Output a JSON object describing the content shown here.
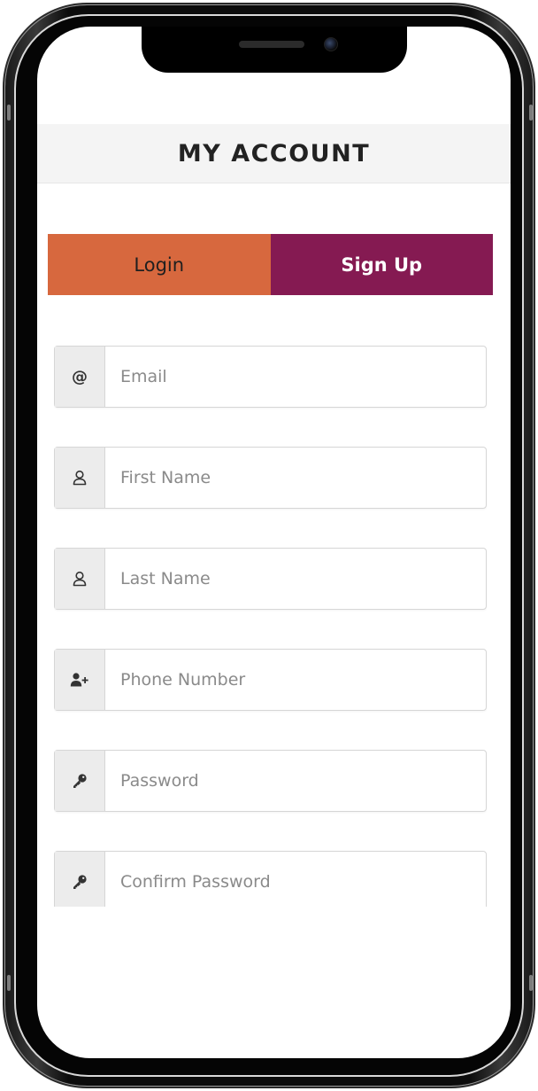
{
  "header": {
    "title": "MY ACCOUNT"
  },
  "tabs": [
    {
      "label": "Login",
      "active": false,
      "color": "#d7683e"
    },
    {
      "label": "Sign Up",
      "active": true,
      "color": "#851a52"
    }
  ],
  "form": {
    "fields": [
      {
        "name": "email",
        "icon": "at-icon",
        "placeholder": "Email",
        "value": ""
      },
      {
        "name": "first_name",
        "icon": "user-icon",
        "placeholder": "First Name",
        "value": ""
      },
      {
        "name": "last_name",
        "icon": "user-icon",
        "placeholder": "Last Name",
        "value": ""
      },
      {
        "name": "phone",
        "icon": "user-plus-icon",
        "placeholder": "Phone Number",
        "value": ""
      },
      {
        "name": "password",
        "icon": "key-icon",
        "placeholder": "Password",
        "value": ""
      },
      {
        "name": "confirm_password",
        "icon": "key-icon",
        "placeholder": "Confirm Password",
        "value": ""
      }
    ]
  },
  "colors": {
    "login_tab": "#d7683e",
    "signup_tab": "#851a52",
    "header_bg": "#f4f4f4"
  }
}
